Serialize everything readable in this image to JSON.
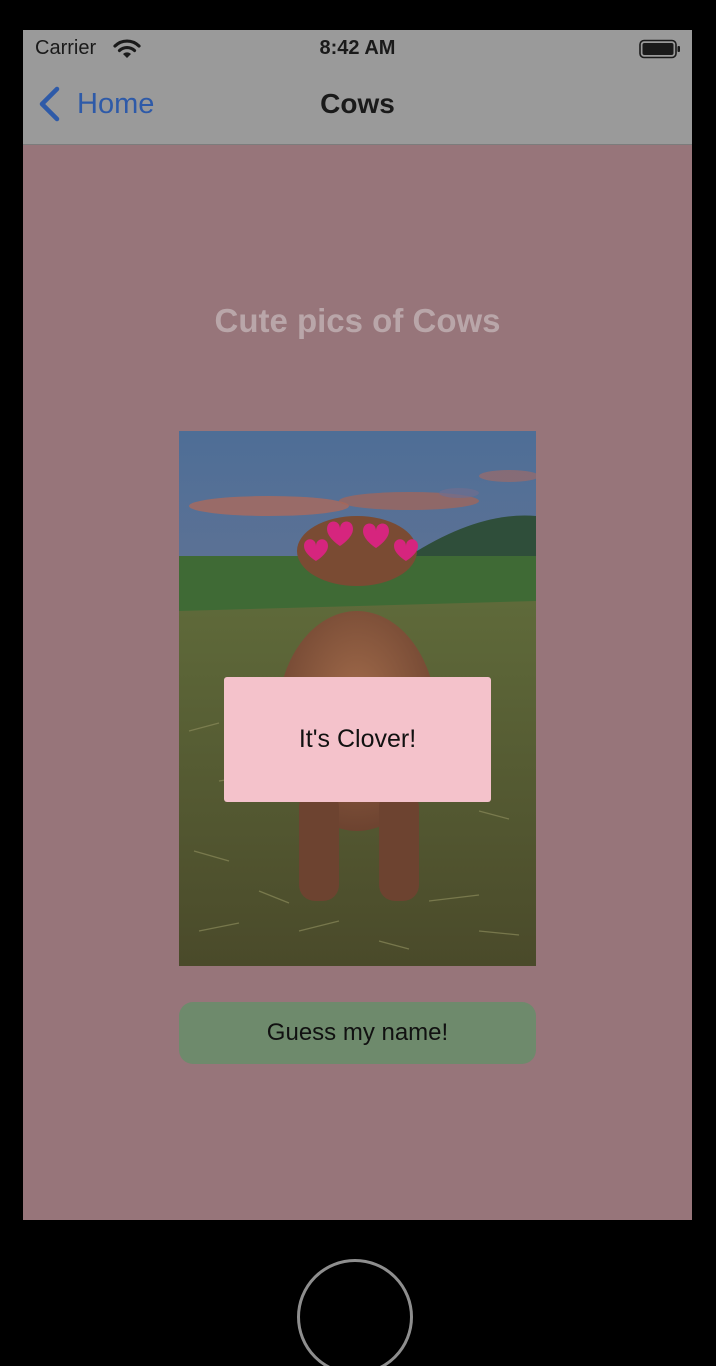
{
  "status_bar": {
    "carrier": "Carrier",
    "time": "8:42 AM",
    "wifi_icon": "wifi-icon",
    "battery_icon": "battery-icon"
  },
  "nav_bar": {
    "back_label": "Home",
    "back_icon": "chevron-left-icon",
    "title": "Cows"
  },
  "content": {
    "heading": "Cute pics of Cows",
    "photo": "highland-calf-photo",
    "button_label": "Guess my name!"
  },
  "popup": {
    "message": "It's Clover!"
  },
  "colors": {
    "background": "#97757a",
    "bars": "#9a9a9a",
    "link": "#2e5aa8",
    "button": "#6e8a6c",
    "popup": "#f4c2cb",
    "heading": "#b9a6a9"
  }
}
